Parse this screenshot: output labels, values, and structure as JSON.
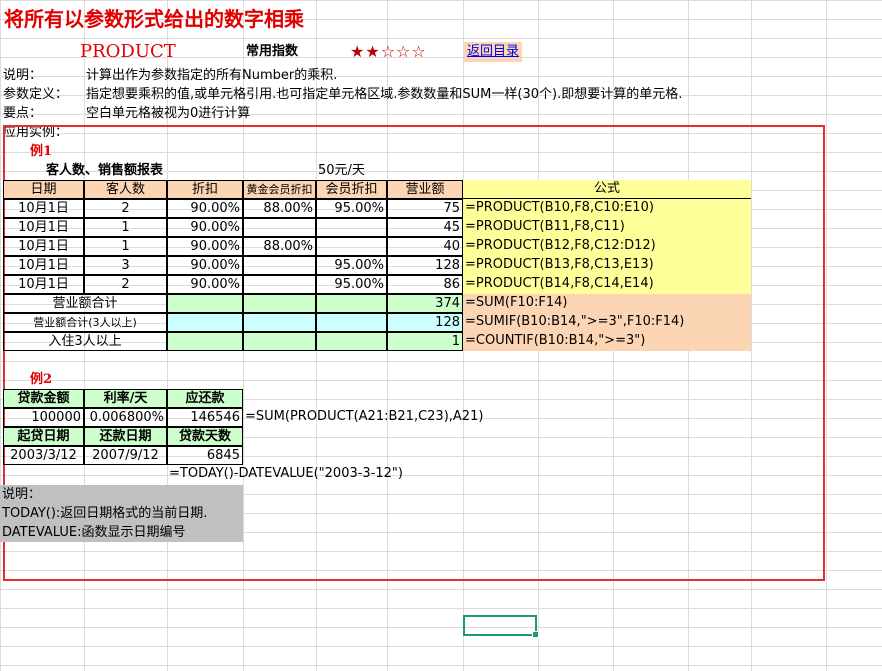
{
  "title": "将所有以参数形式给出的数字相乘",
  "func_name": "PRODUCT",
  "common_index_label": "常用指数",
  "stars": "★★☆☆☆",
  "back_link": "返回目录",
  "desc_label": "说明：",
  "desc_text": "计算出作为参数指定的所有Number的乘积.",
  "param_label": "参数定义：",
  "param_text": "指定想要乘积的值,或单元格引用.也可指定单元格区域.参数数量和SUM一样(30个).即想要计算的单元格.",
  "key_label": "要点：",
  "key_text": "空白单元格被视为0进行计算",
  "example_label": "应用实例：",
  "ex1": {
    "label": "例1",
    "table_title": "客人数、销售额报表",
    "price": "50元/天",
    "headers": [
      "日期",
      "客人数",
      "折扣",
      "黄金会员折扣",
      "会员折扣",
      "营业额"
    ],
    "formula_header": "公式",
    "rows": [
      {
        "date": "10月1日",
        "guests": "2",
        "discount": "90.00%",
        "gold": "88.00%",
        "member": "95.00%",
        "revenue": "75",
        "formula": "=PRODUCT(B10,F8,C10:E10)"
      },
      {
        "date": "10月1日",
        "guests": "1",
        "discount": "90.00%",
        "gold": "",
        "member": "",
        "revenue": "45",
        "formula": "=PRODUCT(B11,F8,C11)"
      },
      {
        "date": "10月1日",
        "guests": "1",
        "discount": "90.00%",
        "gold": "88.00%",
        "member": "",
        "revenue": "40",
        "formula": "=PRODUCT(B12,F8,C12:D12)"
      },
      {
        "date": "10月1日",
        "guests": "3",
        "discount": "90.00%",
        "gold": "",
        "member": "95.00%",
        "revenue": "128",
        "formula": "=PRODUCT(B13,F8,C13,E13)"
      },
      {
        "date": "10月1日",
        "guests": "2",
        "discount": "90.00%",
        "gold": "",
        "member": "95.00%",
        "revenue": "86",
        "formula": "=PRODUCT(B14,F8,C14,E14)"
      }
    ],
    "summary": [
      {
        "label": "营业额合计",
        "value": "374",
        "formula": "=SUM(F10:F14)"
      },
      {
        "label": "营业额合计(3人以上)",
        "value": "128",
        "formula": "=SUMIF(B10:B14,\">=3\",F10:F14)"
      },
      {
        "label": "入住3人以上",
        "value": "1",
        "formula": "=COUNTIF(B10:B14,\">=3\")"
      }
    ]
  },
  "ex2": {
    "label": "例2",
    "headers1": [
      "贷款金额",
      "利率/天",
      "应还款"
    ],
    "row1": [
      "100000",
      "0.006800%",
      "146546"
    ],
    "formula1": "=SUM(PRODUCT(A21:B21,C23),A21)",
    "headers2": [
      "起贷日期",
      "还款日期",
      "贷款天数"
    ],
    "row2": [
      "2003/3/12",
      "2007/9/12",
      "6845"
    ],
    "formula2": "=TODAY()-DATEVALUE(\"2003-3-12\")",
    "notes": [
      "说明：",
      "TODAY():返回日期格式的当前日期.",
      "DATEVALUE:函数显示日期编号"
    ]
  }
}
